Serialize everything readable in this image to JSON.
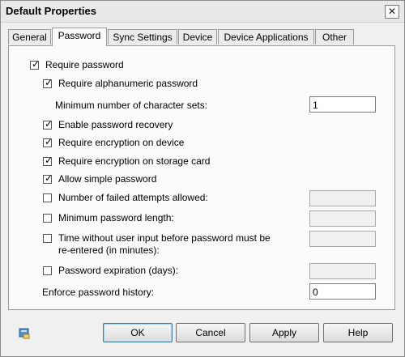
{
  "window": {
    "title": "Default Properties",
    "close_glyph": "✕"
  },
  "tabs": [
    {
      "label": "General"
    },
    {
      "label": "Password"
    },
    {
      "label": "Sync Settings"
    },
    {
      "label": "Device"
    },
    {
      "label": "Device Applications"
    },
    {
      "label": "Other"
    }
  ],
  "active_tab": "Password",
  "check_glyph": "✓",
  "options": {
    "require_password": {
      "label": "Require password",
      "checked": true
    },
    "require_alphanumeric": {
      "label": "Require alphanumeric password",
      "checked": true
    },
    "min_char_sets": {
      "label": "Minimum number of character sets:",
      "value": "1"
    },
    "password_recovery": {
      "label": "Enable password recovery",
      "checked": true
    },
    "encryption_device": {
      "label": "Require encryption on device",
      "checked": true
    },
    "encryption_card": {
      "label": "Require encryption on storage card",
      "checked": true
    },
    "simple_password": {
      "label": "Allow simple password",
      "checked": true
    },
    "failed_attempts": {
      "label": "Number of failed attempts allowed:",
      "checked": false,
      "value": ""
    },
    "min_length": {
      "label": "Minimum password length:",
      "checked": false,
      "value": ""
    },
    "inactivity": {
      "label_line1": "Time without user input before password must be",
      "label_line2": "re-entered (in minutes):",
      "checked": false,
      "value": ""
    },
    "expiration": {
      "label": "Password expiration (days):",
      "checked": false,
      "value": ""
    },
    "history": {
      "label": "Enforce password history:",
      "value": "0"
    }
  },
  "buttons": {
    "ok": "OK",
    "cancel": "Cancel",
    "apply": "Apply",
    "help": "Help"
  },
  "icons": {
    "help": "help-icon"
  }
}
